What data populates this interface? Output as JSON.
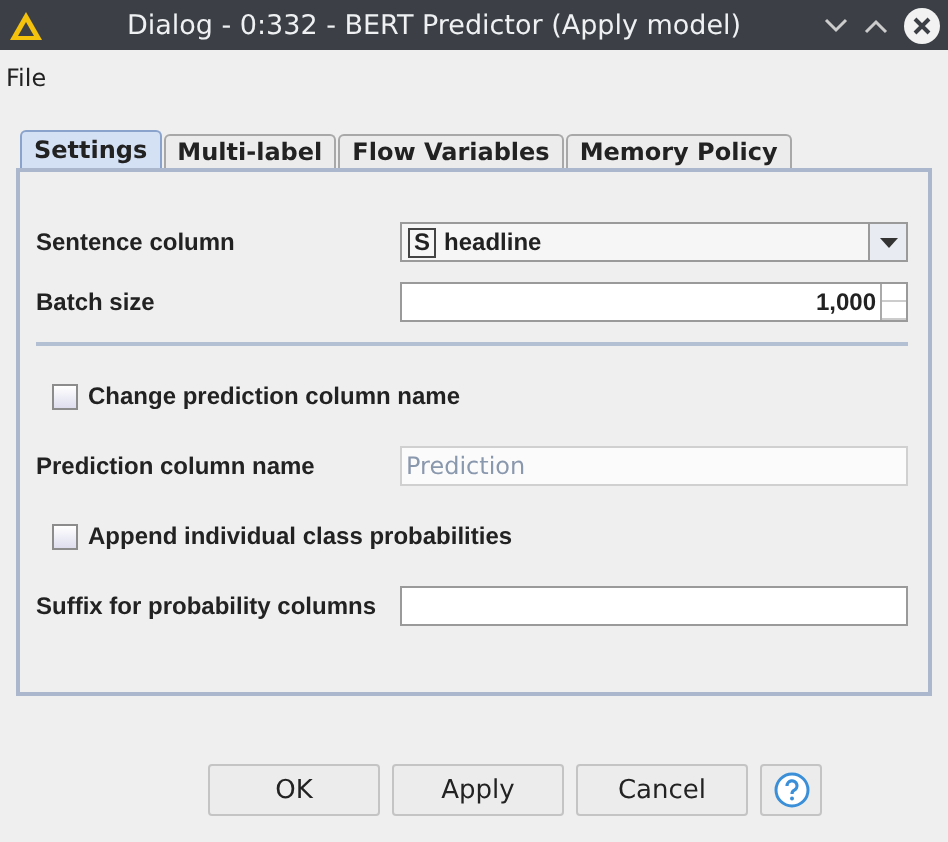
{
  "window": {
    "title": "Dialog - 0:332 - BERT Predictor (Apply model)"
  },
  "menu": [
    "File"
  ],
  "tabs": [
    {
      "label": "Settings",
      "selected": true
    },
    {
      "label": "Multi-label",
      "selected": false
    },
    {
      "label": "Flow Variables",
      "selected": false
    },
    {
      "label": "Memory Policy",
      "selected": false
    }
  ],
  "fields": [
    {
      "kind": "combo",
      "label": "Sentence column",
      "type_badge": "S",
      "value": "headline"
    },
    {
      "kind": "spinner",
      "label": "Batch size",
      "value": "1,000"
    },
    {
      "kind": "separator"
    },
    {
      "kind": "checkbox",
      "label": "Change prediction column name",
      "checked": false
    },
    {
      "kind": "text",
      "label": "Prediction column name",
      "placeholder": "Prediction",
      "disabled": true
    },
    {
      "kind": "checkbox",
      "label": "Append individual class probabilities",
      "checked": false
    },
    {
      "kind": "text",
      "label": "Suffix for probability columns",
      "disabled": false
    }
  ],
  "buttons": [
    "OK",
    "Apply",
    "Cancel"
  ]
}
